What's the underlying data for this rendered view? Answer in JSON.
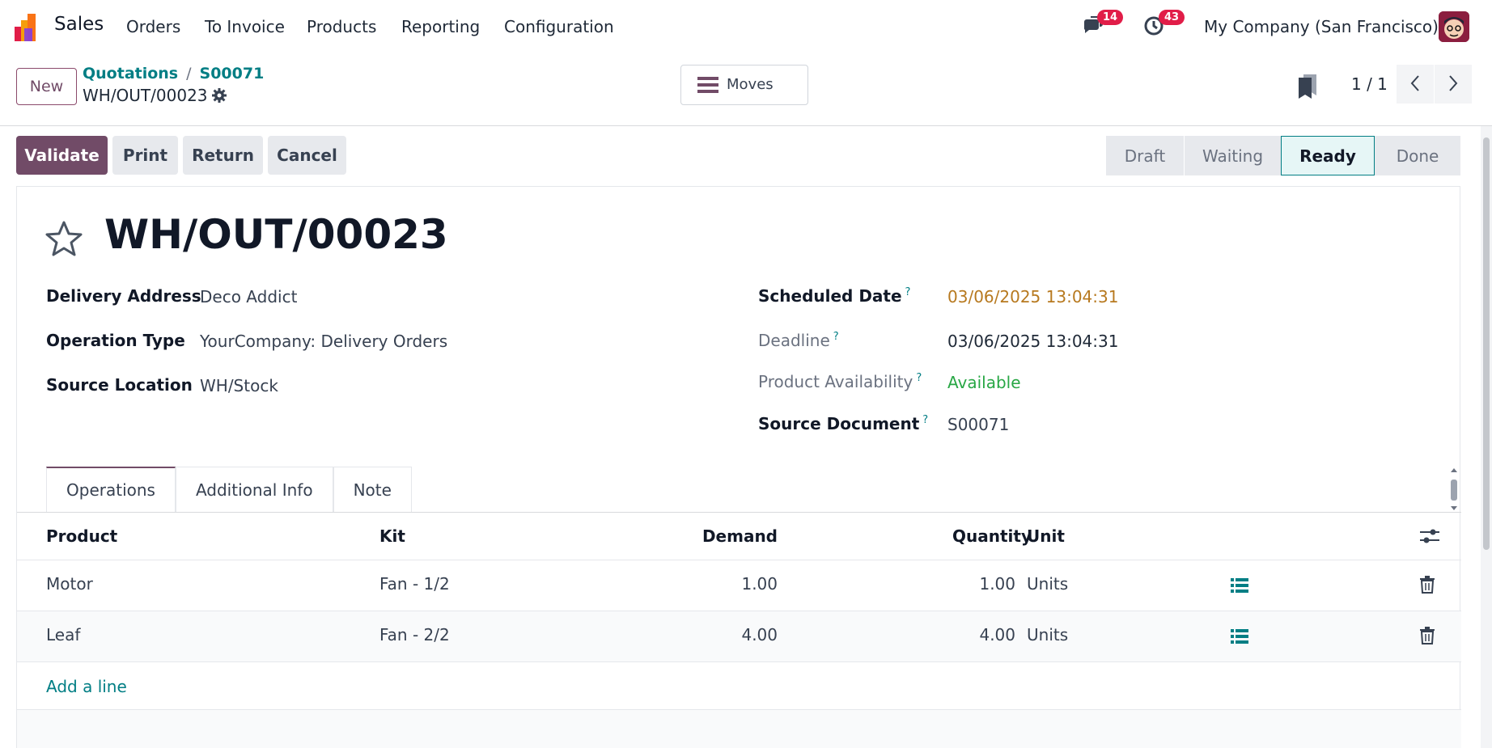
{
  "nav": {
    "app_name": "Sales",
    "menu": [
      "Orders",
      "To Invoice",
      "Products",
      "Reporting",
      "Configuration"
    ],
    "messages_count": "14",
    "activities_count": "43",
    "company": "My Company (San Francisco)"
  },
  "control": {
    "new_label": "New",
    "breadcrumb": [
      "Quotations",
      "S00071"
    ],
    "record_name": "WH/OUT/00023",
    "moves_label": "Moves",
    "pager": "1 / 1"
  },
  "actions": {
    "validate": "Validate",
    "print": "Print",
    "return": "Return",
    "cancel": "Cancel"
  },
  "status": {
    "steps": [
      "Draft",
      "Waiting",
      "Ready",
      "Done"
    ],
    "current": "Ready"
  },
  "record": {
    "title": "WH/OUT/00023",
    "delivery_address_label": "Delivery Address",
    "delivery_address": "Deco Addict",
    "operation_type_label": "Operation Type",
    "operation_type": "YourCompany: Delivery Orders",
    "source_location_label": "Source Location",
    "source_location": "WH/Stock",
    "scheduled_date_label": "Scheduled Date",
    "scheduled_date": "03/06/2025 13:04:31",
    "deadline_label": "Deadline",
    "deadline": "03/06/2025 13:04:31",
    "availability_label": "Product Availability",
    "availability": "Available",
    "source_document_label": "Source Document",
    "source_document": "S00071",
    "help_mark": "?"
  },
  "tabs": [
    "Operations",
    "Additional Info",
    "Note"
  ],
  "table": {
    "headers": [
      "Product",
      "Kit",
      "Demand",
      "Quantity",
      "Unit"
    ],
    "rows": [
      {
        "product": "Motor",
        "kit": "Fan - 1/2",
        "demand": "1.00",
        "quantity": "1.00",
        "unit": "Units"
      },
      {
        "product": "Leaf",
        "kit": "Fan - 2/2",
        "demand": "4.00",
        "quantity": "4.00",
        "unit": "Units"
      }
    ],
    "add_line": "Add a line"
  },
  "colors": {
    "brand": "#714b67",
    "link": "#017e84",
    "scheduled": "#b7791f",
    "available": "#28a745"
  }
}
